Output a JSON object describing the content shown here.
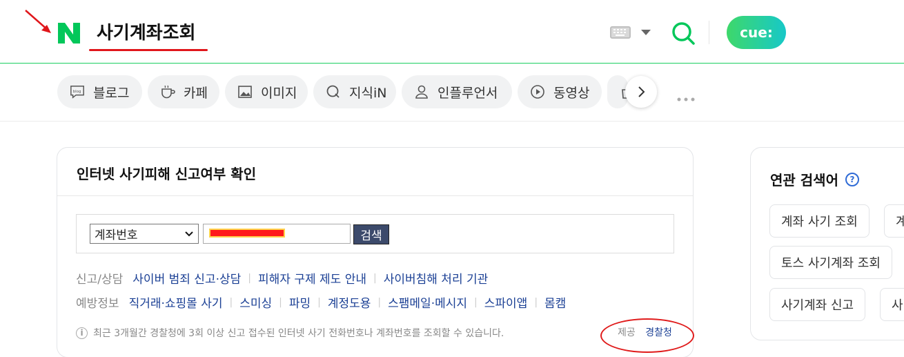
{
  "header": {
    "query": "사기계좌조회",
    "cue_label": "cue:",
    "colors": {
      "brand_green": "#03c75a",
      "annotation_red": "#e0161b"
    }
  },
  "tabs": [
    {
      "label": "블로그",
      "icon": "blog-icon"
    },
    {
      "label": "카페",
      "icon": "cafe-cup-icon"
    },
    {
      "label": "이미지",
      "icon": "image-icon"
    },
    {
      "label": "지식iN",
      "icon": "knowledge-q-icon"
    },
    {
      "label": "인플루언서",
      "icon": "person-icon"
    },
    {
      "label": "동영상",
      "icon": "play-icon"
    }
  ],
  "fraud_card": {
    "title": "인터넷 사기피해 신고여부 확인",
    "select_value": "계좌번호",
    "search_button": "검색",
    "row1": {
      "label": "신고/상담",
      "links": [
        "사이버 범죄 신고·상담",
        "피해자 구제 제도 안내",
        "사이버침해 처리 기관"
      ]
    },
    "row2": {
      "label": "예방정보",
      "links": [
        "직거래·쇼핑몰 사기",
        "스미싱",
        "파밍",
        "계정도용",
        "스팸메일·메시지",
        "스파이앱",
        "몸캠"
      ]
    },
    "notice": "최근 3개월간 경찰청에 3회 이상 신고 접수된 인터넷 사기 전화번호나 계좌번호를 조회할 수 있습니다.",
    "provider_label": "제공",
    "provider_value": "경찰청"
  },
  "related": {
    "title": "연관 검색어",
    "chips": [
      "계좌 사기 조회",
      "계",
      "토스 사기계좌 조회",
      "사기계좌 신고",
      "사"
    ]
  }
}
